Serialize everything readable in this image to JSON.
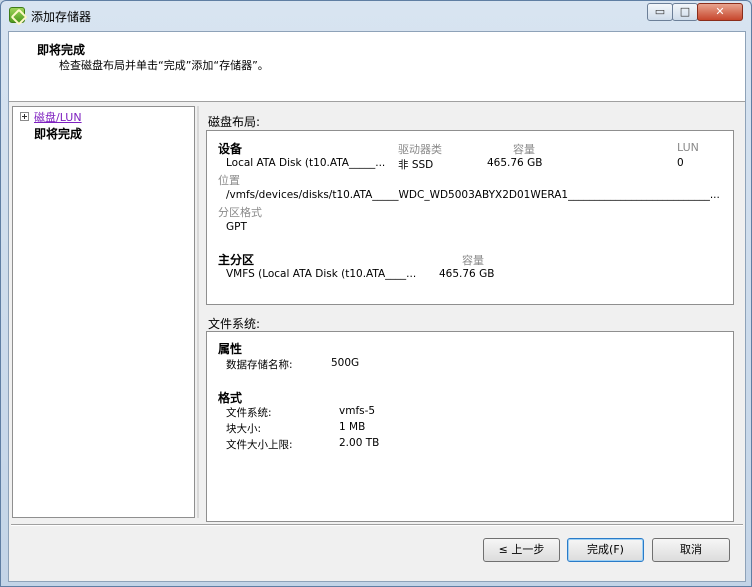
{
  "window": {
    "title": "添加存储器",
    "min_glyph": "▭",
    "max_glyph": "□",
    "close_glyph": "✕"
  },
  "header": {
    "title": "即将完成",
    "subtitle": "检查磁盘布局并单击“完成”添加“存储器”。"
  },
  "nav": {
    "items": [
      {
        "label": "磁盘/LUN",
        "state": "link"
      },
      {
        "label": "即将完成",
        "state": "current"
      }
    ]
  },
  "disk_layout": {
    "section_label": "磁盘布局:",
    "device_heading": "设备",
    "col_drive_type": "驱动器类",
    "col_capacity": "容量",
    "col_lun": "LUN",
    "device_name": "Local ATA Disk (t10.ATA_____...",
    "drive_type": "非 SSD",
    "capacity": "465.76 GB",
    "lun": "0",
    "location_label": "位置",
    "location_value": "/vmfs/devices/disks/t10.ATA_____WDC_WD5003ABYX2D01WERA1___________________________...",
    "partition_format_label": "分区格式",
    "partition_format_value": "GPT",
    "primary_partition_heading": "主分区",
    "primary_capacity_label": "容量",
    "partition_name": "VMFS (Local ATA Disk (t10.ATA____...",
    "partition_capacity": "465.76 GB"
  },
  "file_system": {
    "section_label": "文件系统:",
    "properties_heading": "属性",
    "datastore_name_label": "数据存储名称:",
    "datastore_name_value": "500G",
    "format_heading": "格式",
    "fs_label": "文件系统:",
    "fs_value": "vmfs-5",
    "block_size_label": "块大小:",
    "block_size_value": "1 MB",
    "max_file_size_label": "文件大小上限:",
    "max_file_size_value": "2.00 TB"
  },
  "buttons": {
    "back": "≤ 上一步",
    "finish": "完成(F)",
    "cancel": "取消"
  },
  "colors": {
    "link": "#7d1fbf",
    "gray_label": "#8a8a8a",
    "focus_border": "#2a7bc8"
  }
}
